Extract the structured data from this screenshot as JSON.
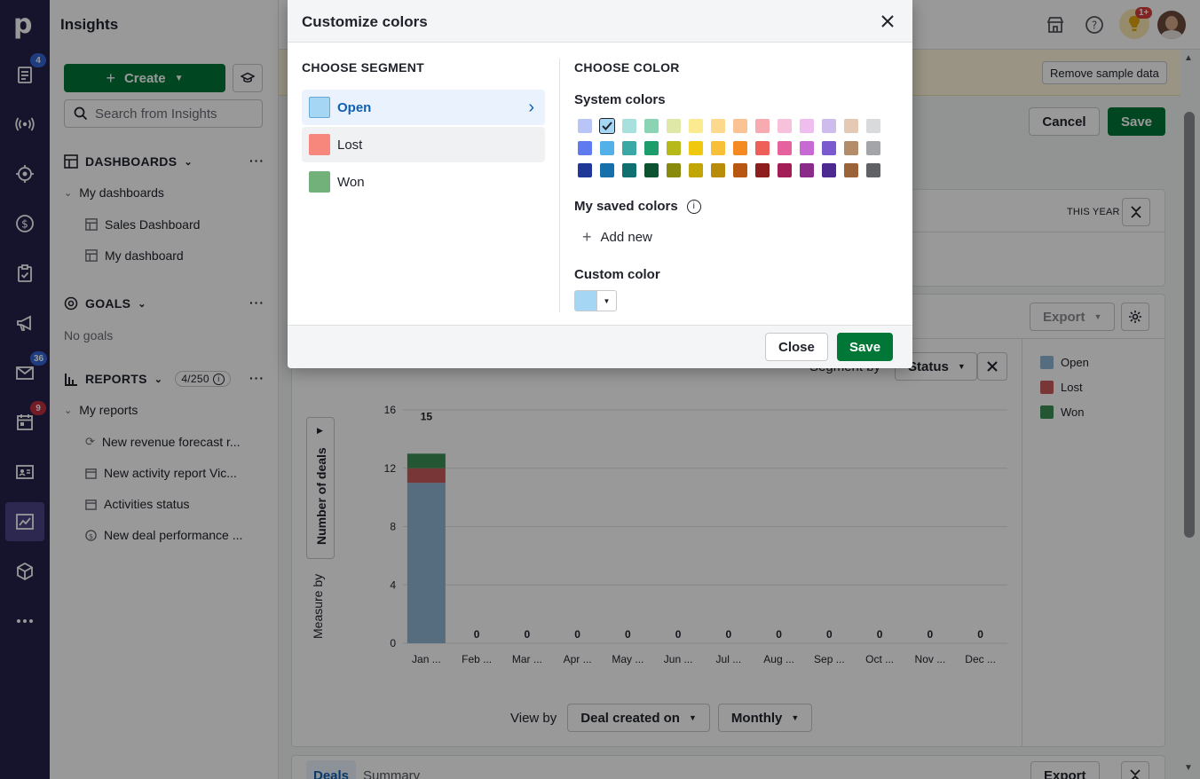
{
  "app": {
    "title": "Insights"
  },
  "rail": {
    "items": [
      {
        "name": "deals-icon",
        "badge": "4",
        "badge_color": "#3367d6"
      },
      {
        "name": "broadcast-icon"
      },
      {
        "name": "target-icon"
      },
      {
        "name": "dollar-icon"
      },
      {
        "name": "clipboard-icon"
      },
      {
        "name": "megaphone-icon"
      },
      {
        "name": "mail-icon",
        "badge": "36",
        "badge_color": "#3367d6"
      },
      {
        "name": "calendar-icon",
        "badge": "9",
        "badge_color": "#c2303f"
      },
      {
        "name": "contacts-icon"
      },
      {
        "name": "insights-icon",
        "active": true
      },
      {
        "name": "box-icon"
      },
      {
        "name": "more-icon"
      }
    ]
  },
  "sidebar": {
    "create_label": "Create",
    "search_placeholder": "Search from Insights",
    "dashboards": {
      "heading": "DASHBOARDS",
      "group": "My dashboards",
      "items": [
        "Sales Dashboard",
        "My dashboard"
      ]
    },
    "goals": {
      "heading": "GOALS",
      "empty": "No goals"
    },
    "reports": {
      "heading": "REPORTS",
      "counter": "4/250",
      "group": "My reports",
      "items": [
        "New revenue forecast r...",
        "New activity report Vic...",
        "Activities status",
        "New deal performance ..."
      ]
    }
  },
  "topbar": {
    "notif_badge": "1+"
  },
  "banner": {
    "remove_label": "Remove sample data"
  },
  "toolbar": {
    "cancel_label": "Cancel",
    "save_label": "Save"
  },
  "filter_card": {
    "period_label": "THIS YEAR"
  },
  "report_card": {
    "export_label": "Export",
    "segment_label": "Segment by",
    "segment_value": "Status",
    "measure_label": "Measure by",
    "measure_value": "Number of deals",
    "view_label": "View by",
    "view_value": "Deal created on",
    "interval_value": "Monthly"
  },
  "chart_data": {
    "type": "bar",
    "stacked": true,
    "categories": [
      "Jan ...",
      "Feb ...",
      "Mar ...",
      "Apr ...",
      "May ...",
      "Jun ...",
      "Jul ...",
      "Aug ...",
      "Sep ...",
      "Oct ...",
      "Nov ...",
      "Dec ..."
    ],
    "totals": [
      "15",
      "0",
      "0",
      "0",
      "0",
      "0",
      "0",
      "0",
      "0",
      "0",
      "0",
      "0"
    ],
    "series": [
      {
        "name": "Open",
        "color": "#8fb5d4",
        "values": [
          11,
          0,
          0,
          0,
          0,
          0,
          0,
          0,
          0,
          0,
          0,
          0
        ]
      },
      {
        "name": "Lost",
        "color": "#c85a5a",
        "values": [
          1,
          0,
          0,
          0,
          0,
          0,
          0,
          0,
          0,
          0,
          0,
          0
        ]
      },
      {
        "name": "Won",
        "color": "#3f8f55",
        "values": [
          1,
          0,
          0,
          0,
          0,
          0,
          0,
          0,
          0,
          0,
          0,
          0
        ]
      }
    ],
    "ylim": [
      0,
      16
    ],
    "yticks": [
      "0",
      "4",
      "8",
      "12",
      "16"
    ],
    "legend_position": "right",
    "grid": true
  },
  "bottom_tabs": {
    "tab1": "Deals",
    "tab2": "Summary",
    "export": "Export"
  },
  "modal": {
    "title": "Customize colors",
    "segment_heading": "CHOOSE SEGMENT",
    "color_heading": "CHOOSE COLOR",
    "segments": [
      {
        "label": "Open",
        "color": "#a5d7f5"
      },
      {
        "label": "Lost",
        "color": "#f7877c"
      },
      {
        "label": "Won",
        "color": "#72b27a"
      }
    ],
    "system_colors_label": "System colors",
    "system_colors": [
      [
        "#b9c5f7",
        "#a5d7f5",
        "#a7e0dc",
        "#8ad4b3",
        "#dfe8a6",
        "#fbea8f",
        "#fcd98c",
        "#fbc393",
        "#f7aab0",
        "#f7c1dc",
        "#efbdee",
        "#cdbcec",
        "#e4c9b4",
        "#d9dadc"
      ],
      [
        "#5f7bef",
        "#53b1ea",
        "#3aa8a5",
        "#1c9d6a",
        "#b7b81a",
        "#f0c90e",
        "#f7c038",
        "#f58a22",
        "#ef5f5a",
        "#e5629e",
        "#c86ad4",
        "#7b5ad0",
        "#b58c6a",
        "#a4a5a9"
      ],
      [
        "#1f3796",
        "#146fab",
        "#107070",
        "#0d5331",
        "#878a0d",
        "#c2a507",
        "#b78c0a",
        "#b75711",
        "#8e1d1d",
        "#a31d57",
        "#8b2a88",
        "#4d2a91",
        "#9c6338",
        "#5f6165"
      ]
    ],
    "selected_color_index": [
      0,
      1
    ],
    "saved_label": "My saved colors",
    "add_new_label": "Add new",
    "custom_label": "Custom color",
    "custom_value": "#a5d7f5",
    "close_label": "Close",
    "save_label": "Save"
  }
}
